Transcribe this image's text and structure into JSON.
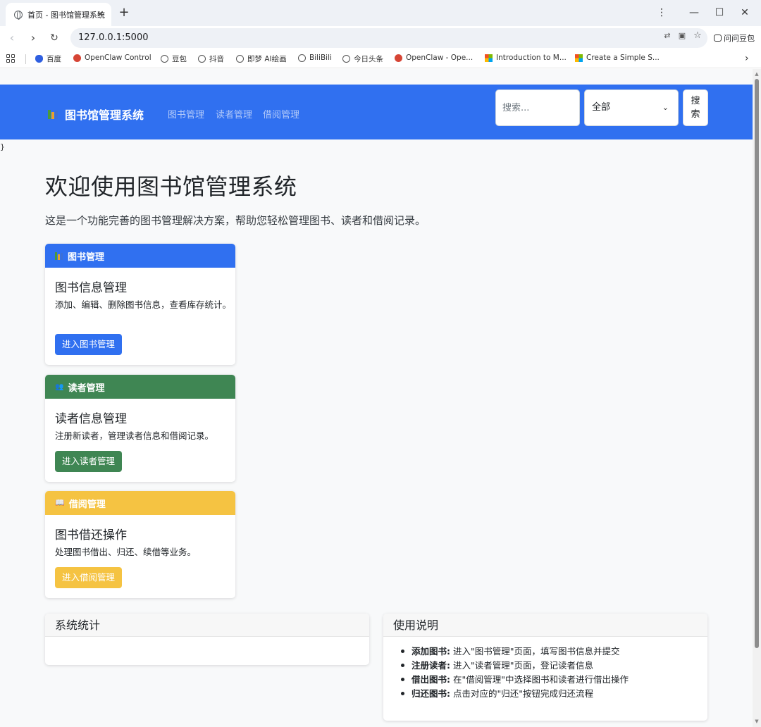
{
  "browser": {
    "tab_title": "首页 - 图书馆管理系统",
    "url": "127.0.0.1:5000",
    "ask_label": "问问豆包",
    "bookmarks": [
      "百度",
      "OpenClaw Control",
      "豆包",
      "抖音",
      "即梦 AI绘画",
      "BiliBili",
      "今日头条",
      "OpenClaw - Ope...",
      "Introduction to M...",
      "Create a Simple S..."
    ]
  },
  "navbar": {
    "brand": "图书馆管理系统",
    "links": [
      "图书管理",
      "读者管理",
      "借阅管理"
    ],
    "search_placeholder": "搜索...",
    "category_selected": "全部",
    "search_button": "搜索"
  },
  "stray_text": "}",
  "main": {
    "heading": "欢迎使用图书馆管理系统",
    "lead": "这是一个功能完善的图书管理解决方案，帮助您轻松管理图书、读者和借阅记录。",
    "cards": [
      {
        "header": "图书管理",
        "title": "图书信息管理",
        "text": "添加、编辑、删除图书信息，查看库存统计。",
        "button": "进入图书管理",
        "color": "#3070f0"
      },
      {
        "header": "读者管理",
        "title": "读者信息管理",
        "text": "注册新读者，管理读者信息和借阅记录。",
        "button": "进入读者管理",
        "color": "#3f8653"
      },
      {
        "header": "借阅管理",
        "title": "图书借还操作",
        "text": "处理图书借出、归还、续借等业务。",
        "button": "进入借阅管理",
        "color": "#f5c342"
      }
    ],
    "stats": {
      "title": "系统统计"
    },
    "usage": {
      "title": "使用说明",
      "items": [
        {
          "term": "添加图书:",
          "desc": "进入\"图书管理\"页面，填写图书信息并提交"
        },
        {
          "term": "注册读者:",
          "desc": "进入\"读者管理\"页面，登记读者信息"
        },
        {
          "term": "借出图书:",
          "desc": "在\"借阅管理\"中选择图书和读者进行借出操作"
        },
        {
          "term": "归还图书:",
          "desc": "点击对应的\"归还\"按钮完成归还流程"
        }
      ]
    }
  }
}
